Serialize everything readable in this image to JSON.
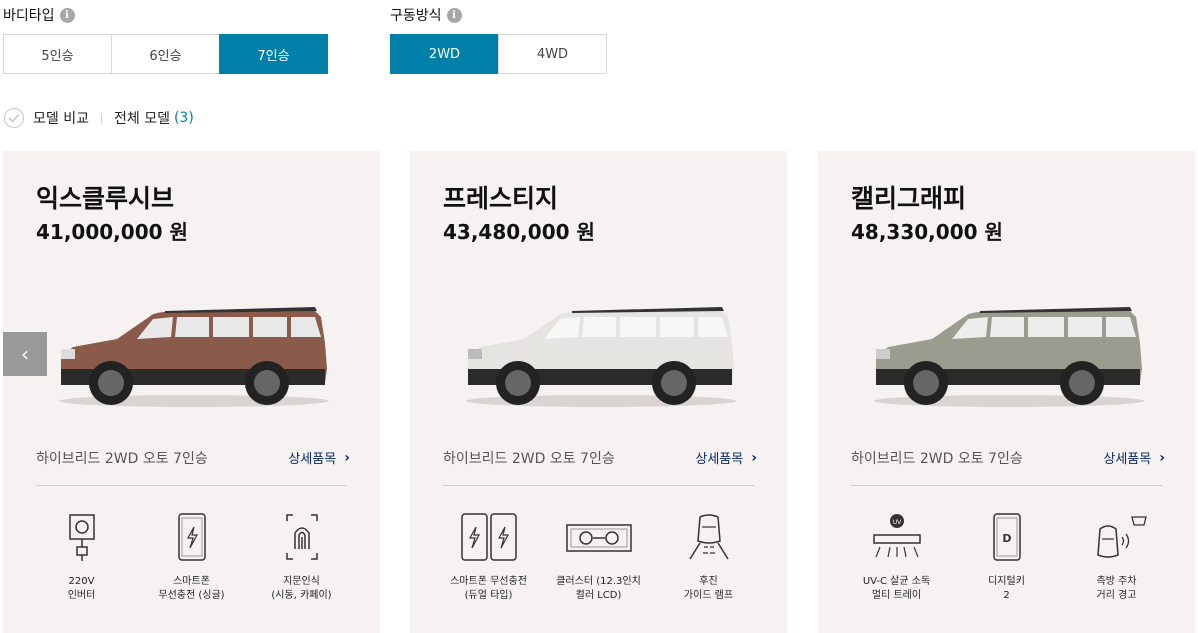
{
  "filters": {
    "body_type": {
      "label": "바디타입",
      "info_icon": "info-icon",
      "options": [
        "5인승",
        "6인승",
        "7인승"
      ],
      "selected": "7인승"
    },
    "drive": {
      "label": "구동방식",
      "info_icon": "info-icon",
      "options": [
        "2WD",
        "4WD"
      ],
      "selected": "2WD"
    }
  },
  "compare": {
    "label": "모델 비교",
    "all_label": "전체 모델",
    "count": "(3)"
  },
  "nav": {
    "prev_icon": "chevron-left-icon",
    "prev_glyph": "‹"
  },
  "colors": {
    "accent": "#007fa8",
    "card_bg": "#f5f2f1",
    "link": "#0a2a6b"
  },
  "models": [
    {
      "name": "익스클루시브",
      "price": "41,000,000 원",
      "car_color": "brown",
      "trim": "하이브리드 2WD 오토 7인승",
      "detail_label": "상세품목",
      "features": [
        {
          "icon": "power-outlet-icon",
          "label": "220V\n인버터"
        },
        {
          "icon": "wireless-charging-icon",
          "label": "스마트폰\n무선충전 (싱글)"
        },
        {
          "icon": "fingerprint-icon",
          "label": "지문인식\n(시동, 카페이)"
        }
      ]
    },
    {
      "name": "프레스티지",
      "price": "43,480,000 원",
      "car_color": "silver",
      "trim": "하이브리드 2WD 오토 7인승",
      "detail_label": "상세품목",
      "features": [
        {
          "icon": "dual-wireless-charging-icon",
          "label": "스마트폰 무선충전\n(듀얼 타입)"
        },
        {
          "icon": "cluster-display-icon",
          "label": "클러스터 (12.3인치\n컬러 LCD)"
        },
        {
          "icon": "reverse-guide-lamp-icon",
          "label": "후진\n가이드 램프"
        }
      ]
    },
    {
      "name": "캘리그래피",
      "price": "48,330,000 원",
      "car_color": "gray",
      "trim": "하이브리드 2WD 오토 7인승",
      "detail_label": "상세품목",
      "features": [
        {
          "icon": "uv-c-sterilizer-icon",
          "label": "UV-C 살균 소독\n멀티 트레이"
        },
        {
          "icon": "digital-key-icon",
          "label": "디지털키\n2"
        },
        {
          "icon": "side-parking-warning-icon",
          "label": "측방 주차\n거리 경고"
        }
      ]
    }
  ]
}
